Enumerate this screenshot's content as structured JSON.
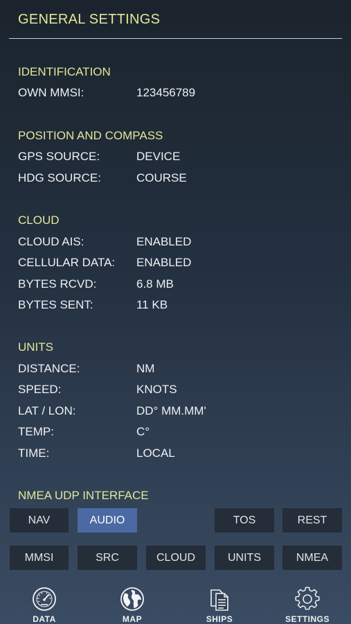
{
  "header": {
    "title": "GENERAL SETTINGS"
  },
  "sections": {
    "identification": {
      "heading": "IDENTIFICATION",
      "rows": [
        {
          "label": "OWN MMSI:",
          "value": "123456789"
        }
      ]
    },
    "position": {
      "heading": "POSITION AND COMPASS",
      "rows": [
        {
          "label": "GPS SOURCE:",
          "value": "DEVICE"
        },
        {
          "label": "HDG SOURCE:",
          "value": "COURSE"
        }
      ]
    },
    "cloud": {
      "heading": "CLOUD",
      "rows": [
        {
          "label": "CLOUD AIS:",
          "value": "ENABLED"
        },
        {
          "label": "CELLULAR DATA:",
          "value": "ENABLED"
        },
        {
          "label": "BYTES RCVD:",
          "value": "6.8 MB"
        },
        {
          "label": "BYTES SENT:",
          "value": "11 KB"
        }
      ]
    },
    "units": {
      "heading": "UNITS",
      "rows": [
        {
          "label": "DISTANCE:",
          "value": "NM"
        },
        {
          "label": "SPEED:",
          "value": "KNOTS"
        },
        {
          "label": "LAT / LON:",
          "value": "DD° MM.MM'"
        },
        {
          "label": "TEMP:",
          "value": "C°"
        },
        {
          "label": "TIME:",
          "value": "LOCAL"
        }
      ]
    },
    "nmea": {
      "heading": "NMEA UDP INTERFACE"
    }
  },
  "buttons": {
    "row1": [
      "NAV",
      "AUDIO",
      "TOS",
      "REST"
    ],
    "row2": [
      "MMSI",
      "SRC",
      "CLOUD",
      "UNITS",
      "NMEA"
    ],
    "active": "AUDIO"
  },
  "tabbar": {
    "items": [
      {
        "label": "DATA",
        "icon": "gauge-icon"
      },
      {
        "label": "MAP",
        "icon": "globe-icon"
      },
      {
        "label": "SHIPS",
        "icon": "documents-icon"
      },
      {
        "label": "SETTINGS",
        "icon": "gear-icon"
      }
    ]
  }
}
